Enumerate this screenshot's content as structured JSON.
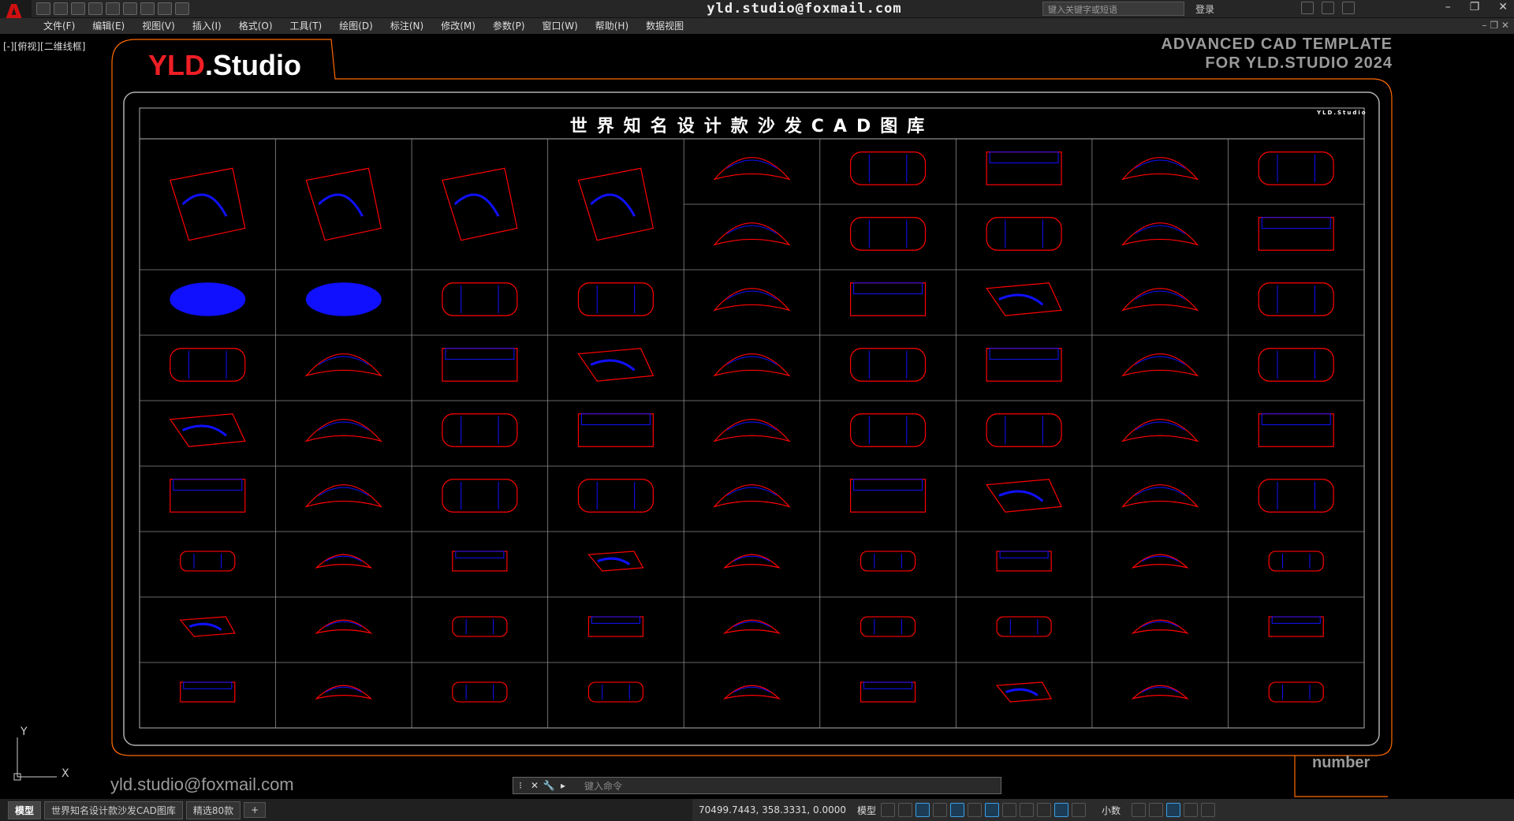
{
  "window": {
    "title": "yld.studio@foxmail.com",
    "search_placeholder": "键入关键字或短语",
    "login": "登录",
    "logo_letter": "A"
  },
  "menu": [
    "文件(F)",
    "编辑(E)",
    "视图(V)",
    "插入(I)",
    "格式(O)",
    "工具(T)",
    "绘图(D)",
    "标注(N)",
    "修改(M)",
    "参数(P)",
    "窗口(W)",
    "帮助(H)",
    "数据视图"
  ],
  "viewport_label": "[-][俯视][二维线框]",
  "drawing": {
    "logo_yld": "YLD",
    "logo_studio": ".Studio",
    "adv_line1": "ADVANCED  CAD  TEMPLATE",
    "adv_line2": "FOR YLD.STUDIO 2024",
    "sheet_title": "世界知名设计款沙发CAD图库",
    "sheet_brand": "YLD.Studio",
    "email": "yld.studio@foxmail.com",
    "number": "number",
    "ucs_y": "Y",
    "ucs_x": "X"
  },
  "cmdline_placeholder": "键入命令",
  "layout_tabs": [
    "模型",
    "世界知名设计款沙发CAD图库",
    "精选80款"
  ],
  "layout_add": "+",
  "status": {
    "coords": "70499.7443, 358.3331, 0.0000",
    "model": "模型",
    "annotation_scale": "小数"
  },
  "colors": {
    "outline": "#ff0000",
    "fill": "#0000ff",
    "frame": "#ff6a00",
    "grid": "#b0b0b0"
  }
}
